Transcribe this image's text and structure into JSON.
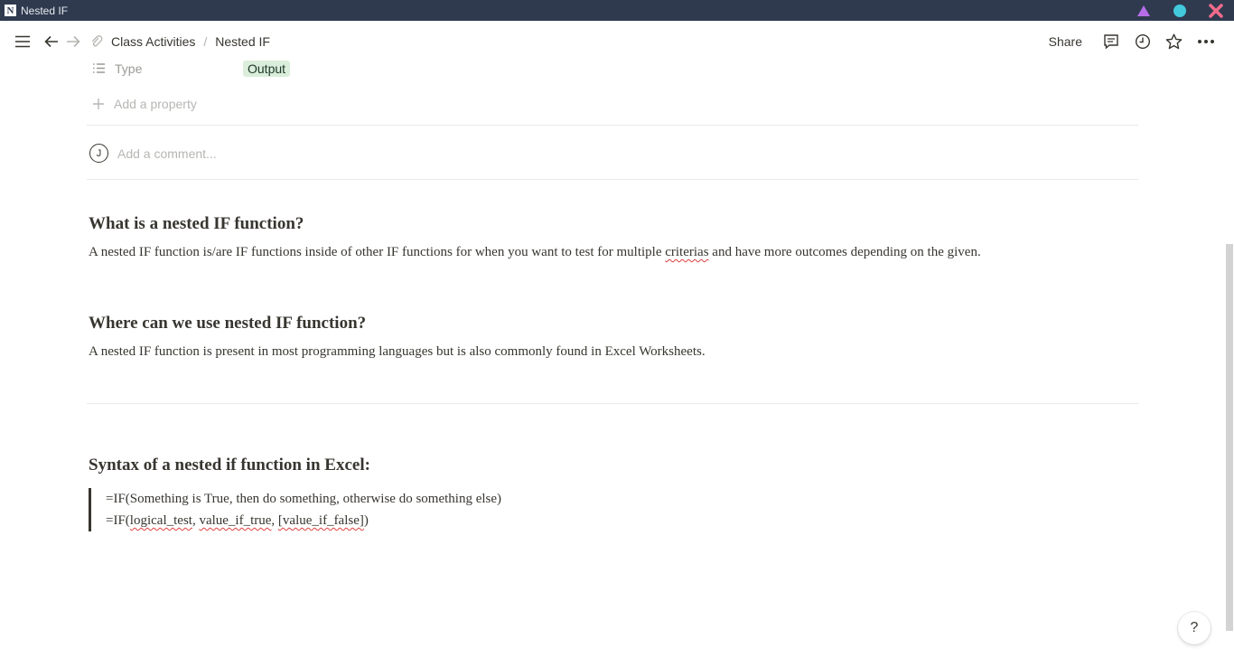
{
  "window": {
    "app_icon": "N",
    "title": "Nested IF",
    "controls": [
      {
        "name": "minimize-icon",
        "color": "#b66ee8"
      },
      {
        "name": "maximize-icon",
        "color": "#42c9dc"
      },
      {
        "name": "close-icon",
        "color": "#f16b8a"
      }
    ]
  },
  "topbar": {
    "breadcrumb": [
      "Class Activities",
      "Nested IF"
    ],
    "breadcrumb_separator": "/",
    "share_label": "Share"
  },
  "properties": {
    "type_label": "Type",
    "type_value": "Output",
    "add_property_label": "Add a property"
  },
  "comment": {
    "avatar_initial": "J",
    "placeholder": "Add a comment..."
  },
  "sections": [
    {
      "heading": "What is a nested IF function?",
      "body_before": "A nested IF function is/are IF functions inside of other IF functions for when you want to test for multiple ",
      "body_misspelled": "criterias",
      "body_after": " and have more outcomes depending on the given."
    },
    {
      "heading": "Where can we use nested IF function?",
      "body": "A nested IF function is present in most programming languages but is also commonly found in Excel Worksheets."
    },
    {
      "heading": "Syntax of a nested if function in Excel:",
      "quote_line1": "=IF(Something is True, then do something, otherwise do something else)",
      "quote_line2": {
        "prefix": "=IF(",
        "arg1": "logical_test",
        "sep1": ", ",
        "arg2": "value_if_true",
        "sep2": ", ",
        "arg3": "[value_if_false]",
        "suffix": ")"
      }
    }
  ],
  "help_label": "?"
}
